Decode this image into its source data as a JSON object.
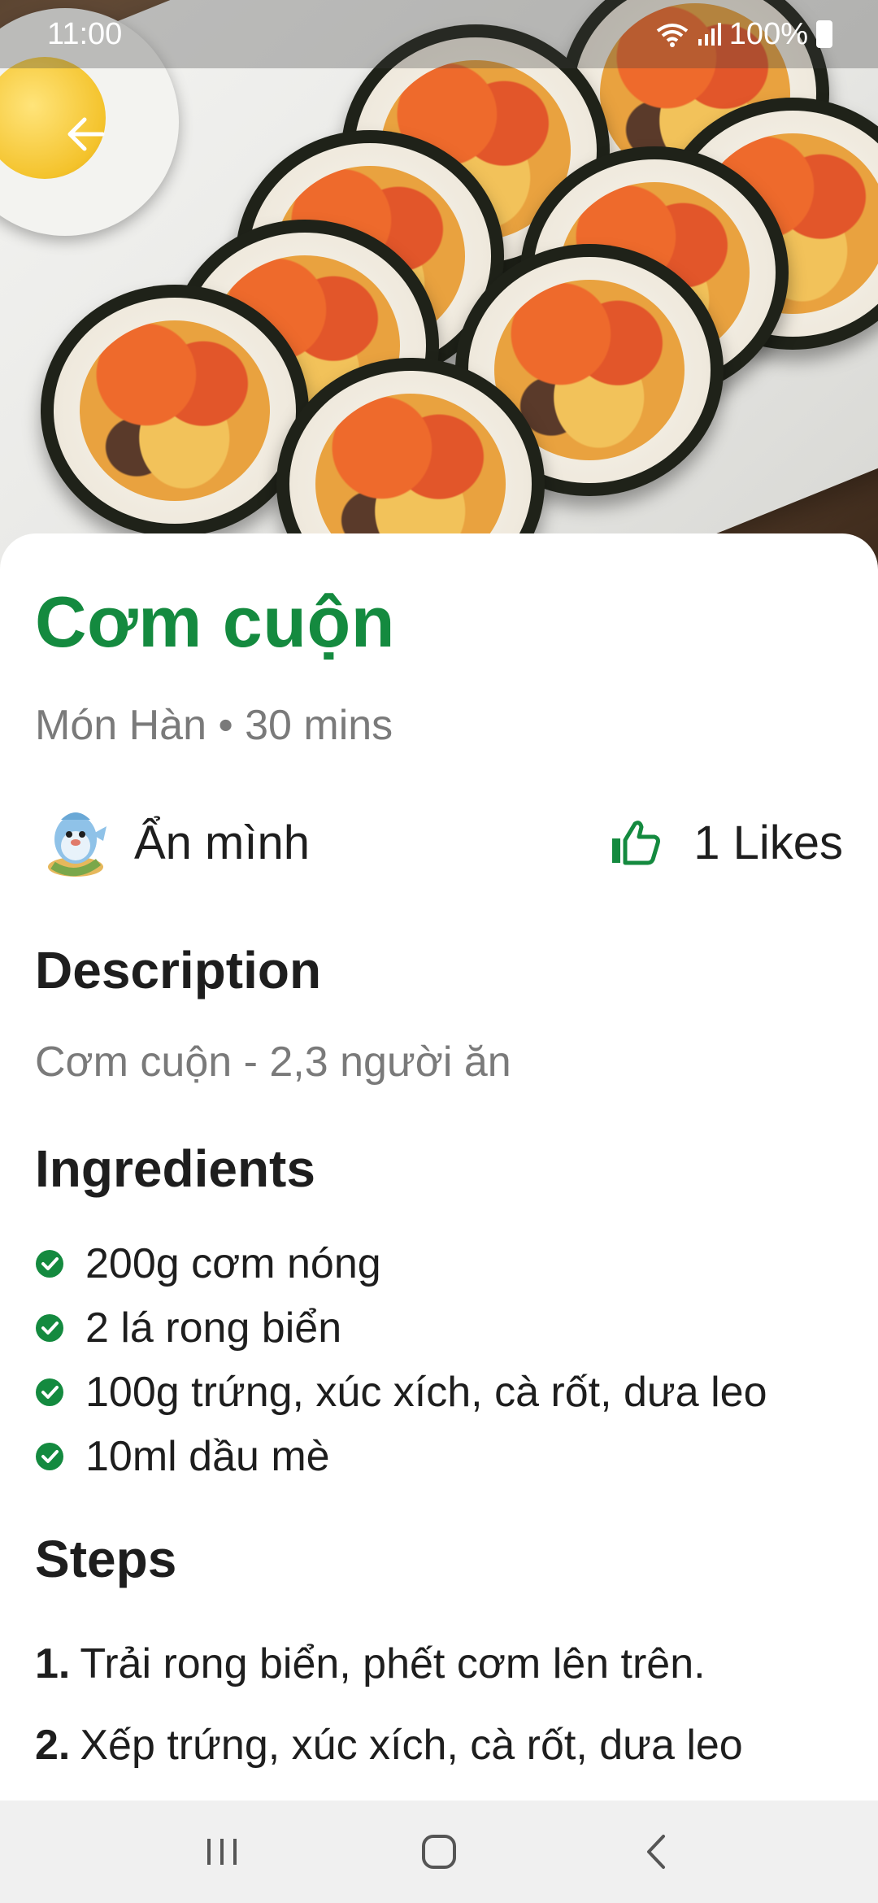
{
  "status_bar": {
    "time": "11:00",
    "battery": "100%",
    "icons": [
      "wifi-icon",
      "signal-icon",
      "battery-icon"
    ]
  },
  "hero": {
    "image": "kimbap-rolls-photo"
  },
  "recipe": {
    "title": "Cơm cuộn",
    "meta": "Món Hàn • 30 mins",
    "author": "Ẩn mình",
    "likes": "1 Likes"
  },
  "description": {
    "heading": "Description",
    "text": "Cơm cuộn - 2,3 người ăn"
  },
  "ingredients": {
    "heading": "Ingredients",
    "items": [
      "200g cơm nóng",
      "2 lá rong biển",
      "100g trứng, xúc xích, cà rốt, dưa leo",
      "10ml dầu mè"
    ]
  },
  "steps": {
    "heading": "Steps",
    "items": [
      {
        "number": "1.",
        "text": "Trải rong biển, phết cơm lên trên."
      },
      {
        "number": "2.",
        "text": "Xếp trứng, xúc xích, cà rốt, dưa leo"
      }
    ]
  },
  "colors": {
    "accent": "#148a3f",
    "muted_text": "#7a7a7a",
    "body_text": "#1e1e1e"
  },
  "nav_bar": {
    "icons": [
      "recent-apps-icon",
      "home-icon",
      "back-icon"
    ]
  }
}
